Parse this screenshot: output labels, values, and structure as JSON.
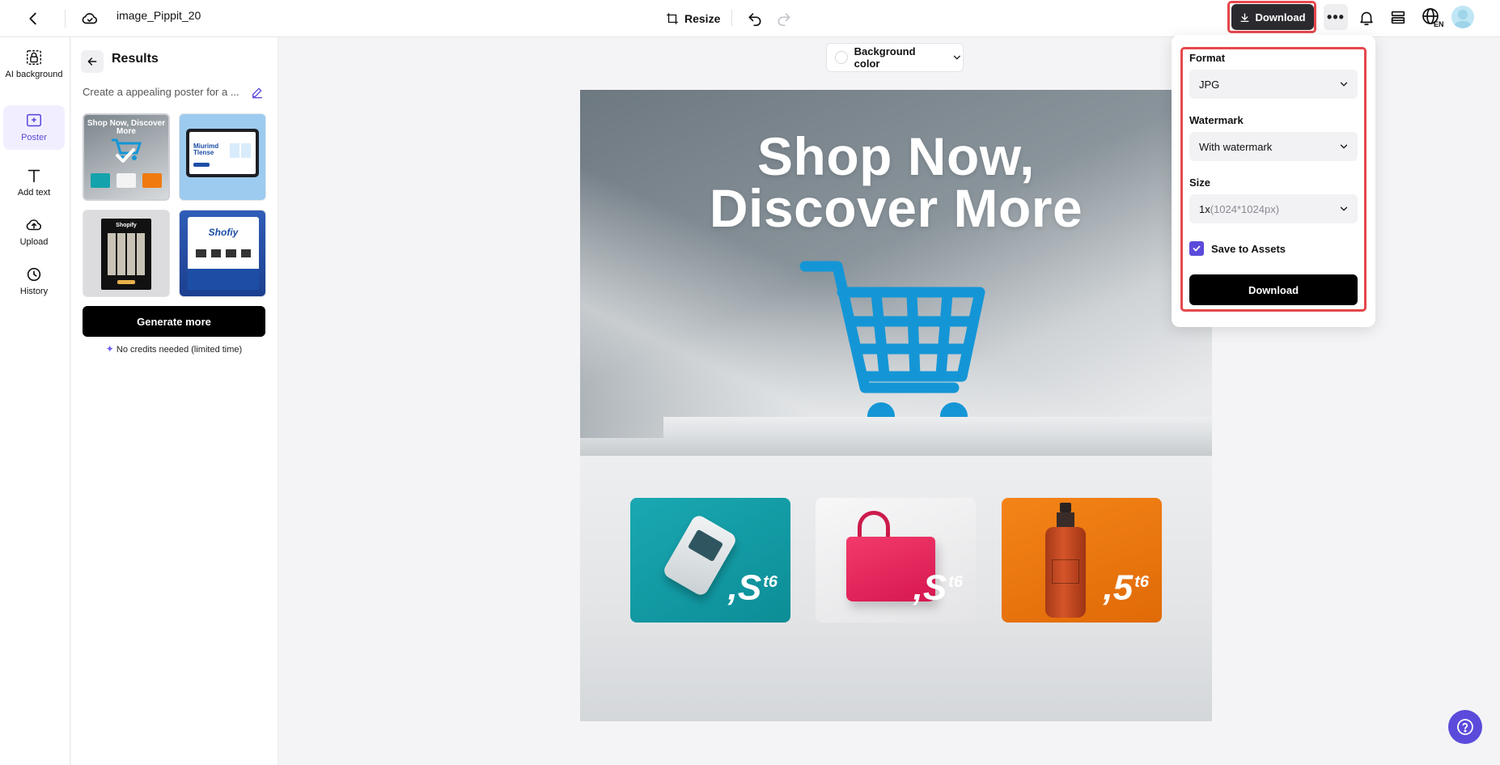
{
  "topbar": {
    "doc_title": "image_Pippit_20",
    "resize_label": "Resize",
    "download_label": "Download",
    "more_label": "•••"
  },
  "rail": {
    "items": [
      {
        "label": "AI background",
        "icon": "ai-background-icon"
      },
      {
        "label": "Poster",
        "icon": "poster-icon",
        "active": true
      },
      {
        "label": "Add text",
        "icon": "text-icon"
      },
      {
        "label": "Upload",
        "icon": "upload-icon"
      },
      {
        "label": "History",
        "icon": "history-icon"
      }
    ]
  },
  "results": {
    "title": "Results",
    "prompt": "Create a appealing poster for a ...",
    "thumbnails": [
      {
        "label": "Shop Now, Discover More"
      },
      {
        "label": "Miurimd Tlense"
      },
      {
        "label": "Shopify"
      },
      {
        "label": "Shofiy"
      }
    ],
    "generate_more": "Generate more",
    "no_credits": "No credits needed (limited time)"
  },
  "canvas": {
    "background_color_label": "Background color",
    "poster": {
      "headline_line1": "Shop Now,",
      "headline_line2": "Discover More",
      "products": [
        {
          "name": "card-reader",
          "price_main": ",S",
          "price_sup": "t6",
          "color": "#14a3ac"
        },
        {
          "name": "shopping-bag",
          "price_main": ",S",
          "price_sup": "t6",
          "color": "#f2f2f3"
        },
        {
          "name": "bottle",
          "price_main": ",5",
          "price_sup": "t6",
          "color": "#f07a10"
        }
      ]
    }
  },
  "download_panel": {
    "format_label": "Format",
    "format_value": "JPG",
    "watermark_label": "Watermark",
    "watermark_value": "With watermark",
    "size_label": "Size",
    "size_value_main": "1x",
    "size_value_detail": "(1024*1024px)",
    "save_to_assets_label": "Save to Assets",
    "save_to_assets_checked": true,
    "download_button": "Download"
  },
  "colors": {
    "accent": "#5b4bdb",
    "highlight_box": "#e5484d",
    "cart_blue": "#1496d6"
  }
}
